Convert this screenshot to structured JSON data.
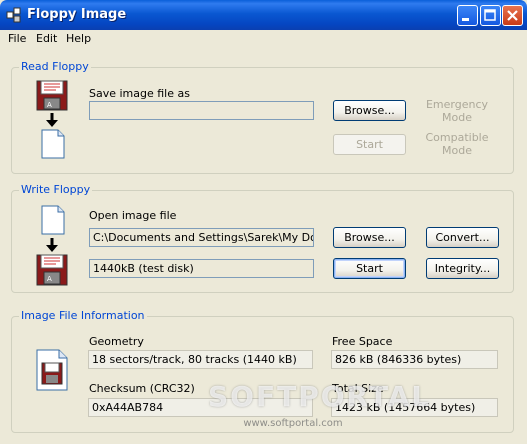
{
  "window": {
    "title": "Floppy Image"
  },
  "menu": {
    "file": "File",
    "edit": "Edit",
    "help": "Help"
  },
  "read_floppy": {
    "title": "Read Floppy",
    "save_label": "Save image file as",
    "save_value": "",
    "browse": "Browse...",
    "start": "Start",
    "emergency_mode": "Emergency Mode",
    "compatible_mode": "Compatible Mode"
  },
  "write_floppy": {
    "title": "Write Floppy",
    "open_label": "Open image file",
    "open_value": "C:\\Documents and Settings\\Sarek\\My Documents",
    "browse": "Browse...",
    "convert": "Convert...",
    "disk_value": "1440kB (test disk)",
    "start": "Start",
    "integrity": "Integrity..."
  },
  "info": {
    "title": "Image File Information",
    "geometry_label": "Geometry",
    "geometry_value": "18 sectors/track, 80 tracks (1440 kB)",
    "free_space_label": "Free Space",
    "free_space_value": "826 kB (846336 bytes)",
    "checksum_label": "Checksum (CRC32)",
    "checksum_value": "0xA44AB784",
    "total_size_label": "Total Size",
    "total_size_value": "1423 kB (1457664 bytes)"
  },
  "watermark": {
    "text": "SOFTPORTAL",
    "url": "www.softportal.com"
  },
  "colors": {
    "titlebar": "#0A58D2",
    "group_title": "#0046D5",
    "window_bg": "#ECE9D8",
    "disabled_text": "#ACA899"
  }
}
